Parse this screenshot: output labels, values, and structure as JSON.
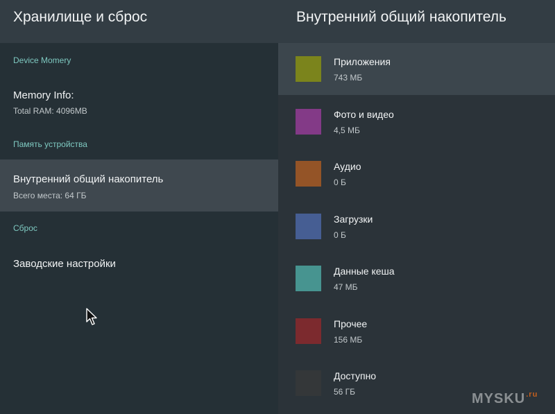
{
  "left": {
    "title": "Хранилище и сброс",
    "section_device": "Device Momery",
    "memory_title": "Memory Info:",
    "memory_sub": "Total RAM: 4096MB",
    "section_storage": "Память устройства",
    "storage_title": "Внутренний общий накопитель",
    "storage_sub": "Всего места: 64 ГБ",
    "section_reset": "Сброс",
    "reset_title": "Заводские настройки"
  },
  "right": {
    "title": "Внутренний общий накопитель",
    "categories": [
      {
        "name": "Приложения",
        "size": "743 МБ",
        "color": "#7b841c"
      },
      {
        "name": "Фото и видео",
        "size": "4,5 МБ",
        "color": "#833a87"
      },
      {
        "name": "Аудио",
        "size": "0 Б",
        "color": "#945427"
      },
      {
        "name": "Загрузки",
        "size": "0 Б",
        "color": "#465e93"
      },
      {
        "name": "Данные кеша",
        "size": "47 МБ",
        "color": "#479490"
      },
      {
        "name": "Прочее",
        "size": "156 МБ",
        "color": "#7c2a2e"
      },
      {
        "name": "Доступно",
        "size": "56 ГБ",
        "color": "#343739"
      }
    ]
  },
  "watermark": {
    "text": "MYSKU",
    "suffix": ".ru"
  },
  "icons": {
    "cursor": "mouse-pointer-icon"
  }
}
